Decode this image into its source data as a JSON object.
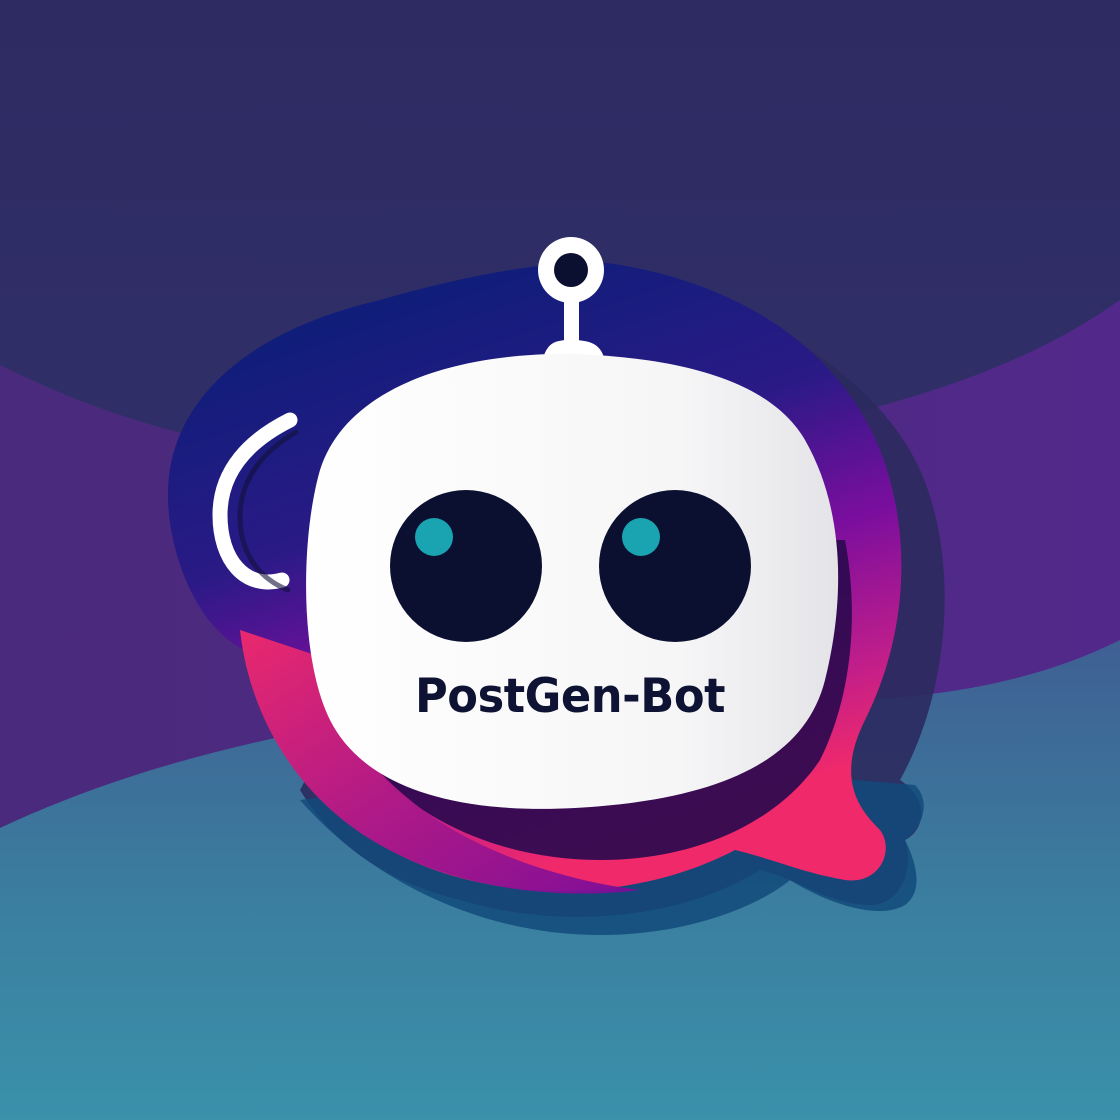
{
  "logo": {
    "wordmark": "PostGen-Bot",
    "icon": "robot-head-chat-bubble-icon"
  },
  "colors": {
    "background_top": "#2e2b62",
    "background_band": "#4a2b80",
    "background_bottom": "#3a8ea8",
    "bubble_navy": "#0d1f78",
    "bubble_purple": "#7a0d9a",
    "bubble_pink": "#f0286c",
    "bubble_shadow_dark": "#2c0a4e",
    "head_white": "#ffffff",
    "eye_dark": "#0c1030",
    "eye_pupil_teal": "#1aa3b0",
    "wordmark_color": "#0e1233"
  }
}
